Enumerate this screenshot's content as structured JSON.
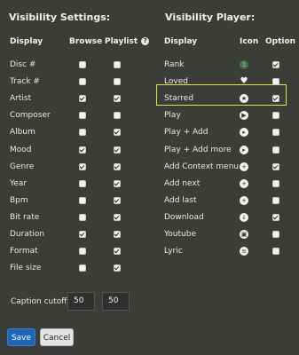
{
  "visibility_settings": {
    "title": "Visibility Settings:",
    "col_display": "Display",
    "col_browse": "Browse",
    "col_playlist": "Playlist",
    "help_glyph": "?",
    "rows": [
      {
        "label": "Disc #",
        "browse": false,
        "playlist": false
      },
      {
        "label": "Track #",
        "browse": false,
        "playlist": false
      },
      {
        "label": "Artist",
        "browse": true,
        "playlist": true
      },
      {
        "label": "Composer",
        "browse": false,
        "playlist": false
      },
      {
        "label": "Album",
        "browse": false,
        "playlist": true
      },
      {
        "label": "Mood",
        "browse": true,
        "playlist": true
      },
      {
        "label": "Genre",
        "browse": true,
        "playlist": true
      },
      {
        "label": "Year",
        "browse": false,
        "playlist": true
      },
      {
        "label": "Bpm",
        "browse": false,
        "playlist": true
      },
      {
        "label": "Bit rate",
        "browse": false,
        "playlist": true
      },
      {
        "label": "Duration",
        "browse": true,
        "playlist": true
      },
      {
        "label": "Format",
        "browse": false,
        "playlist": true
      },
      {
        "label": "File size",
        "browse": false,
        "playlist": true
      }
    ]
  },
  "visibility_player": {
    "title": "Visibility Player:",
    "col_display": "Display",
    "col_icon": "Icon",
    "col_option": "Option",
    "rows": [
      {
        "label": "Rank",
        "icon": "rank-icon",
        "glyph": "1",
        "style": "dim",
        "option": true
      },
      {
        "label": "Loved",
        "icon": "heart-icon",
        "glyph": "♥",
        "style": "plain",
        "option": false
      },
      {
        "label": "Starred",
        "icon": "star-icon",
        "glyph": "★",
        "style": "solid",
        "option": true
      },
      {
        "label": "Play",
        "icon": "play-icon",
        "glyph": "▶",
        "style": "solid",
        "option": false
      },
      {
        "label": "Play + Add",
        "icon": "play-add-icon",
        "glyph": "▸",
        "style": "solid",
        "option": false
      },
      {
        "label": "Play + Add more",
        "icon": "play-add-more-icon",
        "glyph": "▸",
        "style": "solid",
        "option": false
      },
      {
        "label": "Add Context menu",
        "icon": "add-context-icon",
        "glyph": "+",
        "style": "solid",
        "option": true
      },
      {
        "label": "Add next",
        "icon": "add-next-icon",
        "glyph": "+",
        "style": "solid",
        "option": false
      },
      {
        "label": "Add last",
        "icon": "add-last-icon",
        "glyph": "+",
        "style": "solid",
        "option": false
      },
      {
        "label": "Download",
        "icon": "download-icon",
        "glyph": "↓",
        "style": "solid",
        "option": true
      },
      {
        "label": "Youtube",
        "icon": "youtube-icon",
        "glyph": "▣",
        "style": "solid",
        "option": false
      },
      {
        "label": "Lyric",
        "icon": "lyric-icon",
        "glyph": "≡",
        "style": "solid",
        "option": false
      }
    ]
  },
  "caption_cutoff": {
    "label": "Caption cutoff",
    "value1": "50",
    "value2": "50"
  },
  "buttons": {
    "save": "Save",
    "cancel": "Cancel"
  },
  "colors": {
    "background": "#3b3d39",
    "highlight": "#e8e04a",
    "save": "#1f66b6"
  }
}
